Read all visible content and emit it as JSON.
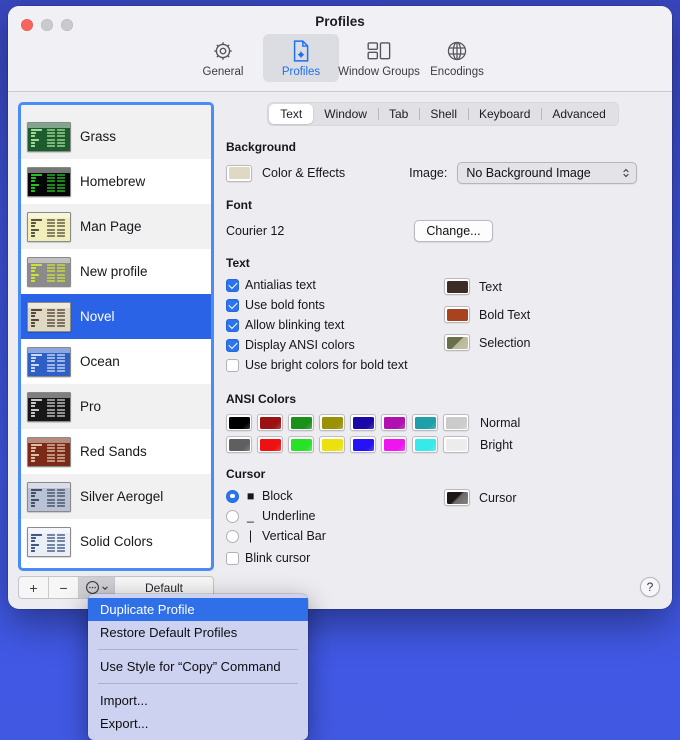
{
  "window": {
    "title": "Profiles",
    "traffic": {
      "close": "close-button",
      "minimize": "minimize-button",
      "maximize": "maximize-button"
    }
  },
  "toolbar": {
    "items": [
      {
        "label": "General",
        "icon": "gear-icon",
        "active": false
      },
      {
        "label": "Profiles",
        "icon": "document-icon",
        "active": true
      },
      {
        "label": "Window Groups",
        "icon": "window-groups-icon",
        "active": false
      },
      {
        "label": "Encodings",
        "icon": "globe-icon",
        "active": false
      }
    ]
  },
  "sidebar": {
    "profiles": [
      {
        "name": "Grass",
        "bg": "#1c5c2e",
        "fg": "#baf0a8",
        "selected": false
      },
      {
        "name": "Homebrew",
        "bg": "#060606",
        "fg": "#2de02d",
        "selected": false
      },
      {
        "name": "Man Page",
        "bg": "#f2eebb",
        "fg": "#3a3a2a",
        "selected": false
      },
      {
        "name": "New profile",
        "bg": "#8b8b8b",
        "fg": "#d8f028",
        "selected": false
      },
      {
        "name": "Novel",
        "bg": "#dfd9c3",
        "fg": "#3d2b25",
        "selected": true
      },
      {
        "name": "Ocean",
        "bg": "#2d5fc4",
        "fg": "#e8f0ff",
        "selected": false
      },
      {
        "name": "Pro",
        "bg": "#171717",
        "fg": "#e6e6e6",
        "selected": false
      },
      {
        "name": "Red Sands",
        "bg": "#7c2a18",
        "fg": "#f0d8c0",
        "selected": false
      },
      {
        "name": "Silver Aerogel",
        "bg": "#b9c2d4",
        "fg": "#2b3a52",
        "selected": false
      },
      {
        "name": "Solid Colors",
        "bg": "#e9eef7",
        "fg": "#23406e",
        "selected": false
      }
    ],
    "toolbar": {
      "add_label": "+",
      "remove_label": "−",
      "more_label": "more-actions",
      "default_label": "Default"
    }
  },
  "tabs": [
    {
      "label": "Text",
      "selected": true
    },
    {
      "label": "Window",
      "selected": false
    },
    {
      "label": "Tab",
      "selected": false
    },
    {
      "label": "Shell",
      "selected": false
    },
    {
      "label": "Keyboard",
      "selected": false
    },
    {
      "label": "Advanced",
      "selected": false
    }
  ],
  "text_tab": {
    "background": {
      "title": "Background",
      "color_effects_label": "Color & Effects",
      "color": "#dfd9c3",
      "image_label": "Image:",
      "image_value": "No Background Image",
      "image_options": [
        "No Background Image"
      ]
    },
    "font": {
      "title": "Font",
      "value": "Courier 12",
      "change_label": "Change..."
    },
    "text": {
      "title": "Text",
      "checkboxes": [
        {
          "label": "Antialias text",
          "checked": true
        },
        {
          "label": "Use bold fonts",
          "checked": true
        },
        {
          "label": "Allow blinking text",
          "checked": true
        },
        {
          "label": "Display ANSI colors",
          "checked": true
        },
        {
          "label": "Use bright colors for bold text",
          "checked": false
        }
      ],
      "swatches": [
        {
          "label": "Text",
          "color": "#3d2b25"
        },
        {
          "label": "Bold Text",
          "color": "#a8431f"
        },
        {
          "label": "Selection",
          "color": "#6e7350"
        }
      ]
    },
    "ansi": {
      "title": "ANSI Colors",
      "rows": [
        {
          "label": "Normal",
          "colors": [
            "#000000",
            "#9c1212",
            "#1a9118",
            "#9a9105",
            "#1a09a8",
            "#b110b1",
            "#1f9fa8",
            "#cbcbcb"
          ]
        },
        {
          "label": "Bright",
          "colors": [
            "#5f5f5f",
            "#ee1111",
            "#28e228",
            "#ece10e",
            "#2512f5",
            "#ef15ef",
            "#37eaea",
            "#ececec"
          ]
        }
      ]
    },
    "cursor": {
      "title": "Cursor",
      "options": [
        {
          "label": "Block",
          "glyph": "■",
          "selected": true
        },
        {
          "label": "Underline",
          "glyph": "_",
          "selected": false
        },
        {
          "label": "Vertical Bar",
          "glyph": "|",
          "selected": false
        }
      ],
      "blink": {
        "label": "Blink cursor",
        "checked": false
      },
      "swatch": {
        "label": "Cursor",
        "color": "#4c4a48"
      }
    },
    "help_label": "?"
  },
  "context_menu": {
    "items": [
      {
        "label": "Duplicate Profile",
        "selected": true,
        "separator_after": false
      },
      {
        "label": "Restore Default Profiles",
        "selected": false,
        "separator_after": true
      },
      {
        "label": "Use Style for “Copy” Command",
        "selected": false,
        "separator_after": true
      },
      {
        "label": "Import...",
        "selected": false,
        "separator_after": false
      },
      {
        "label": "Export...",
        "selected": false,
        "separator_after": false
      }
    ]
  }
}
